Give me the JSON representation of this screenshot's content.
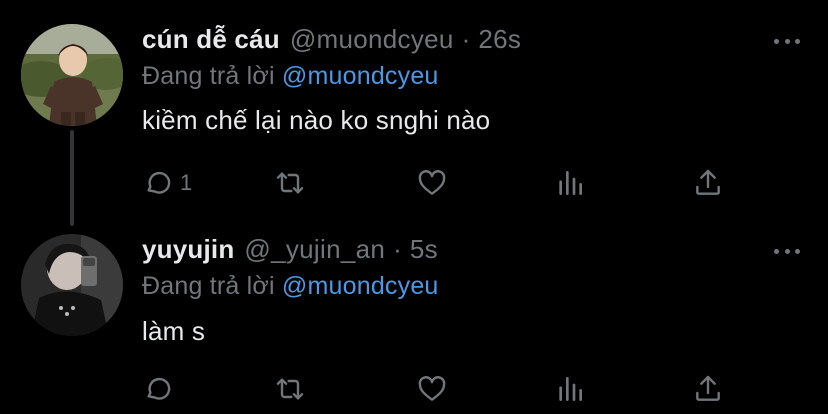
{
  "tweets": [
    {
      "name": "cún dễ cáu",
      "handle": "@muondcyeu",
      "separator": "·",
      "time": "26s",
      "reply_prefix": "Đang trả lời",
      "reply_to": "@muondcyeu",
      "text": "kiềm chế lại nào ko snghi nào",
      "reply_count": "1",
      "icons": {
        "reply": "reply-icon",
        "retweet": "retweet-icon",
        "like": "heart-icon",
        "stats": "stats-icon",
        "share": "share-icon",
        "more": "more-icon"
      }
    },
    {
      "name": "yuyujin",
      "handle": "@_yujin_an",
      "separator": "·",
      "time": "5s",
      "reply_prefix": "Đang trả lời",
      "reply_to": "@muondcyeu",
      "text": "làm s",
      "reply_count": "",
      "icons": {
        "reply": "reply-icon",
        "retweet": "retweet-icon",
        "like": "heart-icon",
        "stats": "stats-icon",
        "share": "share-icon",
        "more": "more-icon"
      }
    }
  ],
  "colors": {
    "background": "#000000",
    "text": "#e7e9ea",
    "muted": "#71767b",
    "mention": "#4a99e9",
    "thread_line": "#333639"
  }
}
